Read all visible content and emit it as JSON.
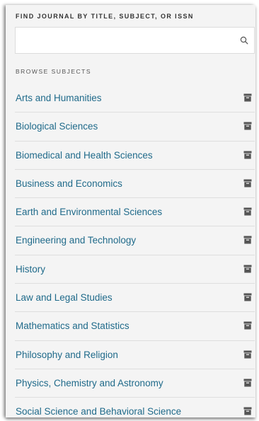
{
  "search": {
    "heading": "FIND JOURNAL BY TITLE, SUBJECT, OR ISSN",
    "value": "",
    "placeholder": "",
    "icon": "search-icon"
  },
  "browse": {
    "heading": "BROWSE SUBJECTS",
    "item_icon": "archive-box-icon",
    "items": [
      {
        "label": "Arts and Humanities"
      },
      {
        "label": "Biological Sciences"
      },
      {
        "label": "Biomedical and Health Sciences"
      },
      {
        "label": "Business and Economics"
      },
      {
        "label": "Earth and Environmental Sciences"
      },
      {
        "label": "Engineering and Technology"
      },
      {
        "label": "History"
      },
      {
        "label": "Law and Legal Studies"
      },
      {
        "label": "Mathematics and Statistics"
      },
      {
        "label": "Philosophy and Religion"
      },
      {
        "label": "Physics, Chemistry and Astronomy"
      },
      {
        "label": "Social Science and Behavioral Science"
      }
    ]
  },
  "colors": {
    "link": "#1f6a8a",
    "panel_bg": "#f4f4f4",
    "icon": "#555555"
  }
}
